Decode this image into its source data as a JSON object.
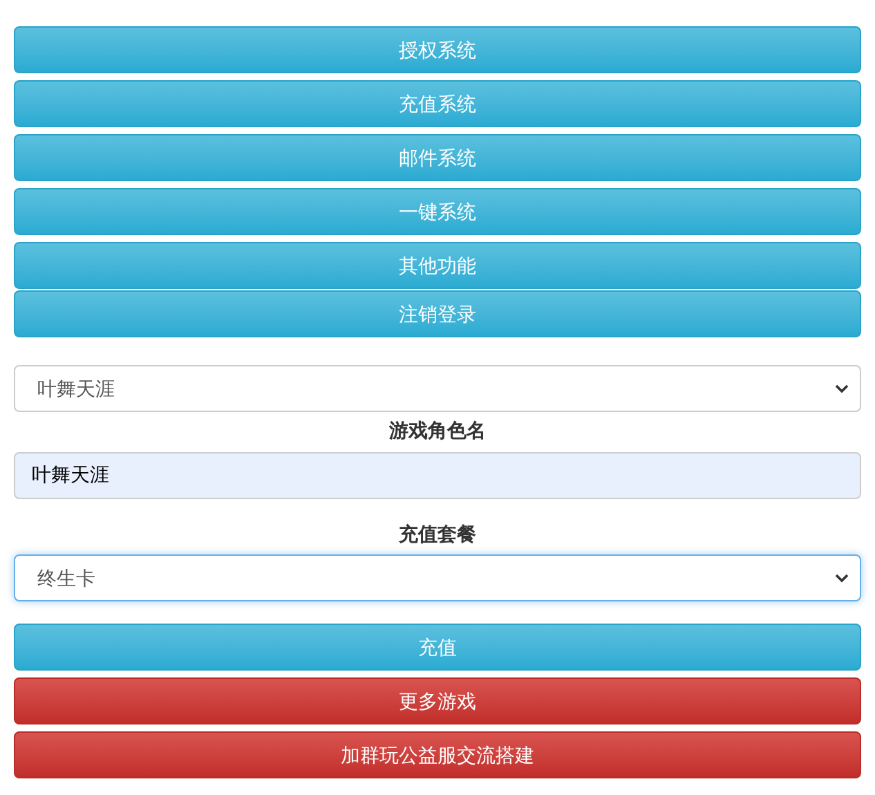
{
  "menu_buttons": [
    {
      "label": "授权系统"
    },
    {
      "label": "充值系统"
    },
    {
      "label": "邮件系统"
    },
    {
      "label": "一键系统"
    },
    {
      "label": "其他功能"
    }
  ],
  "logout_button": {
    "label": "注销登录"
  },
  "server_select": {
    "value": "叶舞天涯",
    "focused": false
  },
  "role_name": {
    "label": "游戏角色名",
    "value": "叶舞天涯"
  },
  "package": {
    "label": "充值套餐",
    "select": {
      "value": "终生卡",
      "focused": true
    }
  },
  "action_buttons": [
    {
      "label": "充值",
      "kind": "info"
    },
    {
      "label": "更多游戏",
      "kind": "danger"
    },
    {
      "label": "加群玩公益服交流搭建",
      "kind": "danger"
    }
  ]
}
